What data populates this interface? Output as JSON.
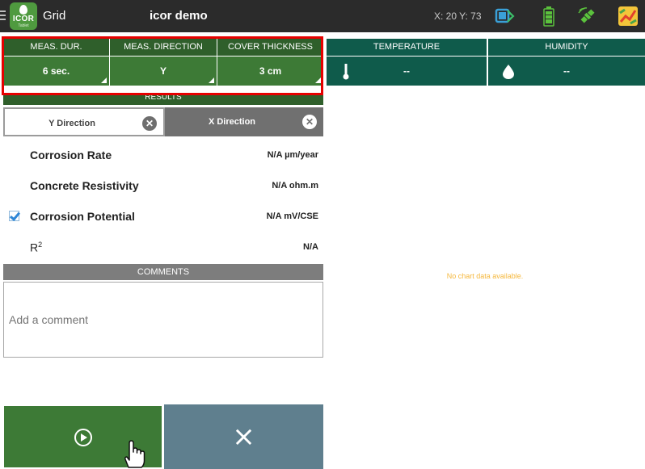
{
  "header": {
    "logo_text": "ICOR",
    "logo_sub": "Tablet",
    "app_title": "Grid",
    "project_title": "icor demo",
    "coordinates": "X: 20 Y: 73",
    "icons": [
      "menu-icon",
      "bluetooth-device-icon",
      "battery-icon",
      "gps-satellite-icon",
      "map-icon"
    ]
  },
  "settings": {
    "headers": [
      "MEAS. DUR.",
      "MEAS. DIRECTION",
      "COVER THICKNESS"
    ],
    "values": [
      "6 sec.",
      "Y",
      "3 cm"
    ]
  },
  "sensors": {
    "temperature": {
      "label": "TEMPERATURE",
      "value": "--",
      "icon": "thermometer-icon"
    },
    "humidity": {
      "label": "HUMIDITY",
      "value": "--",
      "icon": "water-drop-icon"
    }
  },
  "results": {
    "title": "RESULTS",
    "tabs": [
      {
        "label": "Y Direction",
        "active": true
      },
      {
        "label": "X Direction",
        "active": false
      }
    ],
    "rows": [
      {
        "label": "Corrosion Rate",
        "value": "N/A µm/year"
      },
      {
        "label": "Concrete Resistivity",
        "value": "N/A ohm.m"
      },
      {
        "label": "Corrosion Potential",
        "value": "N/A mV/CSE",
        "checked": true
      },
      {
        "label": "R",
        "sup": "2",
        "value": "N/A"
      }
    ]
  },
  "comments": {
    "title": "COMMENTS",
    "placeholder": "Add a comment",
    "value": ""
  },
  "chart": {
    "empty_message": "No chart data available."
  },
  "actions": {
    "start_icon": "play-circle-icon",
    "cancel_label": "×"
  },
  "colors": {
    "accent_green": "#3d7a36",
    "header_green": "#2f5f2b",
    "sensor_teal": "#0f5b4b",
    "highlight_red": "#e60000",
    "cancel_slate": "#5f7f8e"
  }
}
